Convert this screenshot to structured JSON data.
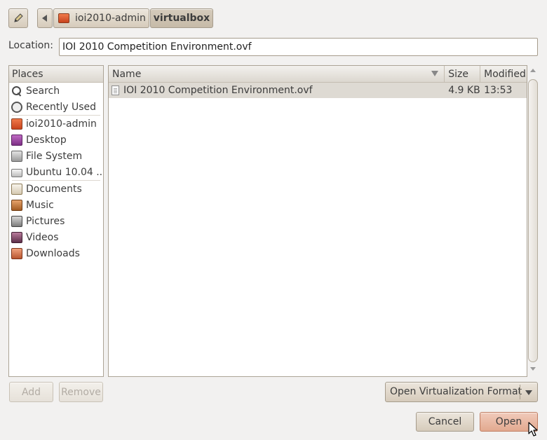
{
  "pathbar": {
    "edit_icon": "pencil-icon",
    "back_icon": "left-arrow-icon",
    "crumbs": [
      {
        "label": "ioi2010-admin",
        "icon": "home-folder-icon"
      },
      {
        "label": "virtualbox"
      }
    ]
  },
  "location": {
    "label": "Location:",
    "value": "IOI 2010 Competition Environment.ovf"
  },
  "places": {
    "header": "Places",
    "items": [
      {
        "label": "Search",
        "icon": "search-icon"
      },
      {
        "label": "Recently Used",
        "icon": "clock-icon"
      },
      {
        "label": "ioi2010-admin",
        "icon": "home-folder-icon"
      },
      {
        "label": "Desktop",
        "icon": "desktop-icon"
      },
      {
        "label": "File System",
        "icon": "drive-icon"
      },
      {
        "label": "Ubuntu 10.04 ...",
        "icon": "disk-icon"
      },
      {
        "label": "Documents",
        "icon": "documents-folder-icon"
      },
      {
        "label": "Music",
        "icon": "music-folder-icon"
      },
      {
        "label": "Pictures",
        "icon": "pictures-folder-icon"
      },
      {
        "label": "Videos",
        "icon": "videos-folder-icon"
      },
      {
        "label": "Downloads",
        "icon": "downloads-folder-icon"
      }
    ]
  },
  "files": {
    "columns": {
      "name": "Name",
      "size": "Size",
      "modified": "Modified"
    },
    "rows": [
      {
        "name": "IOI 2010 Competition Environment.ovf",
        "size": "4.9 KB",
        "modified": "13:53",
        "icon": "document-icon"
      }
    ]
  },
  "buttons": {
    "add": "Add",
    "remove": "Remove",
    "cancel": "Cancel",
    "open": "Open"
  },
  "filter": {
    "selected": "Open Virtualization Format"
  },
  "colors": {
    "window_bg": "#f2f1f0",
    "selection_bg": "#dedad3",
    "primary_button": "#e2a98f"
  }
}
